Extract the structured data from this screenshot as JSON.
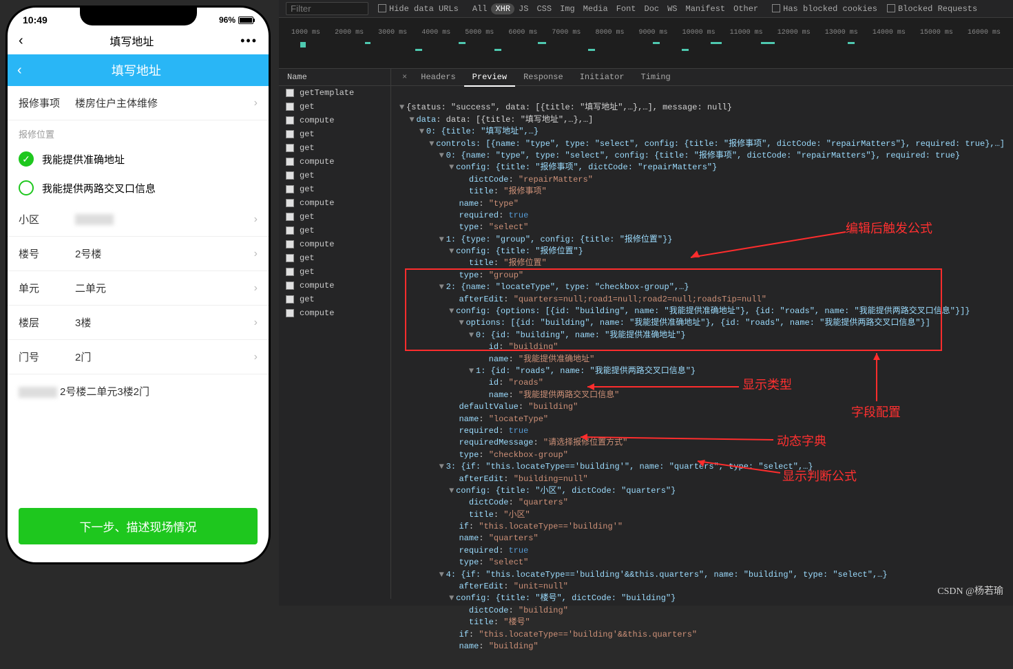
{
  "phone": {
    "time": "10:49",
    "battery_pct": "96%",
    "nav_title": "填写地址",
    "page_title": "填写地址",
    "form": {
      "repair_label": "报修事项",
      "repair_value": "楼房住户主体维修",
      "section_label": "报修位置",
      "radio1": "我能提供准确地址",
      "radio2": "我能提供两路交叉口信息",
      "rows": [
        {
          "label": "小区",
          "value": ""
        },
        {
          "label": "楼号",
          "value": "2号楼"
        },
        {
          "label": "单元",
          "value": "二单元"
        },
        {
          "label": "楼层",
          "value": "3楼"
        },
        {
          "label": "门号",
          "value": "2门"
        }
      ],
      "summary_suffix": "2号楼二单元3楼2门",
      "next_btn": "下一步、描述现场情况"
    }
  },
  "devtools": {
    "filter_placeholder": "Filter",
    "hide_data_urls": "Hide data URLs",
    "types": [
      "All",
      "XHR",
      "JS",
      "CSS",
      "Img",
      "Media",
      "Font",
      "Doc",
      "WS",
      "Manifest",
      "Other"
    ],
    "has_blocked_cookies": "Has blocked cookies",
    "blocked_requests": "Blocked Requests",
    "ruler": [
      "1000 ms",
      "2000 ms",
      "3000 ms",
      "4000 ms",
      "5000 ms",
      "6000 ms",
      "7000 ms",
      "8000 ms",
      "9000 ms",
      "10000 ms",
      "11000 ms",
      "12000 ms",
      "13000 ms",
      "14000 ms",
      "15000 ms",
      "16000 ms"
    ],
    "name_header": "Name",
    "requests": [
      "getTemplate",
      "get",
      "compute",
      "get",
      "get",
      "compute",
      "get",
      "get",
      "compute",
      "get",
      "get",
      "compute",
      "get",
      "get",
      "compute",
      "get",
      "compute"
    ],
    "tabs": [
      "Headers",
      "Preview",
      "Response",
      "Initiator",
      "Timing"
    ],
    "active_tab": "Preview",
    "annotations": {
      "a1": "编辑后触发公式",
      "a2": "显示类型",
      "a3": "字段配置",
      "a4": "动态字典",
      "a5": "显示判断公式"
    },
    "json": {
      "root": "{status: \"success\", data: [{title: \"填写地址\",…},…], message: null}",
      "data_line": "data: [{title: \"填写地址\",…},…]",
      "idx0": "0: {title: \"填写地址\",…}",
      "controls": "controls: [{name: \"type\", type: \"select\", config: {title: \"报修事项\", dictCode: \"repairMatters\"}, required: true},…]",
      "c0": "0: {name: \"type\", type: \"select\", config: {title: \"报修事项\", dictCode: \"repairMatters\"}, required: true}",
      "c0_config": "config: {title: \"报修事项\", dictCode: \"repairMatters\"}",
      "c0_dictCode": "dictCode: \"repairMatters\"",
      "c0_title": "title: \"报修事项\"",
      "c0_name": "name: \"type\"",
      "c0_required": "required: true",
      "c0_type": "type: \"select\"",
      "c1": "1: {type: \"group\", config: {title: \"报修位置\"}}",
      "c1_config": "config: {title: \"报修位置\"}",
      "c1_title": "title: \"报修位置\"",
      "c1_type": "type: \"group\"",
      "c2": "2: {name: \"locateType\", type: \"checkbox-group\",…}",
      "c2_afterEdit": "afterEdit: \"quarters=null;road1=null;road2=null;roadsTip=null\"",
      "c2_config": "config: {options: [{id: \"building\", name: \"我能提供准确地址\"}, {id: \"roads\", name: \"我能提供两路交叉口信息\"}]}",
      "c2_options": "options: [{id: \"building\", name: \"我能提供准确地址\"}, {id: \"roads\", name: \"我能提供两路交叉口信息\"}]",
      "c2_opt0": "0: {id: \"building\", name: \"我能提供准确地址\"}",
      "c2_opt0_id": "id: \"building\"",
      "c2_opt0_name": "name: \"我能提供准确地址\"",
      "c2_opt1": "1: {id: \"roads\", name: \"我能提供两路交叉口信息\"}",
      "c2_opt1_id": "id: \"roads\"",
      "c2_opt1_name": "name: \"我能提供两路交叉口信息\"",
      "c2_default": "defaultValue: \"building\"",
      "c2_name": "name: \"locateType\"",
      "c2_required": "required: true",
      "c2_reqmsg": "requiredMessage: \"请选择报修位置方式\"",
      "c2_type": "type: \"checkbox-group\"",
      "c3": "3: {if: \"this.locateType=='building'\", name: \"quarters\", type: \"select\",…}",
      "c3_afterEdit": "afterEdit: \"building=null\"",
      "c3_config": "config: {title: \"小区\", dictCode: \"quarters\"}",
      "c3_dictCode": "dictCode: \"quarters\"",
      "c3_title": "title: \"小区\"",
      "c3_if": "if: \"this.locateType=='building'\"",
      "c3_name": "name: \"quarters\"",
      "c3_required": "required: true",
      "c3_type": "type: \"select\"",
      "c4": "4: {if: \"this.locateType=='building'&&this.quarters\", name: \"building\", type: \"select\",…}",
      "c4_afterEdit": "afterEdit: \"unit=null\"",
      "c4_config": "config: {title: \"楼号\", dictCode: \"building\"}",
      "c4_dictCode": "dictCode: \"building\"",
      "c4_title": "title: \"楼号\"",
      "c4_if": "if: \"this.locateType=='building'&&this.quarters\"",
      "c4_name": "name: \"building\""
    }
  },
  "watermark": "CSDN @杨若瑜"
}
